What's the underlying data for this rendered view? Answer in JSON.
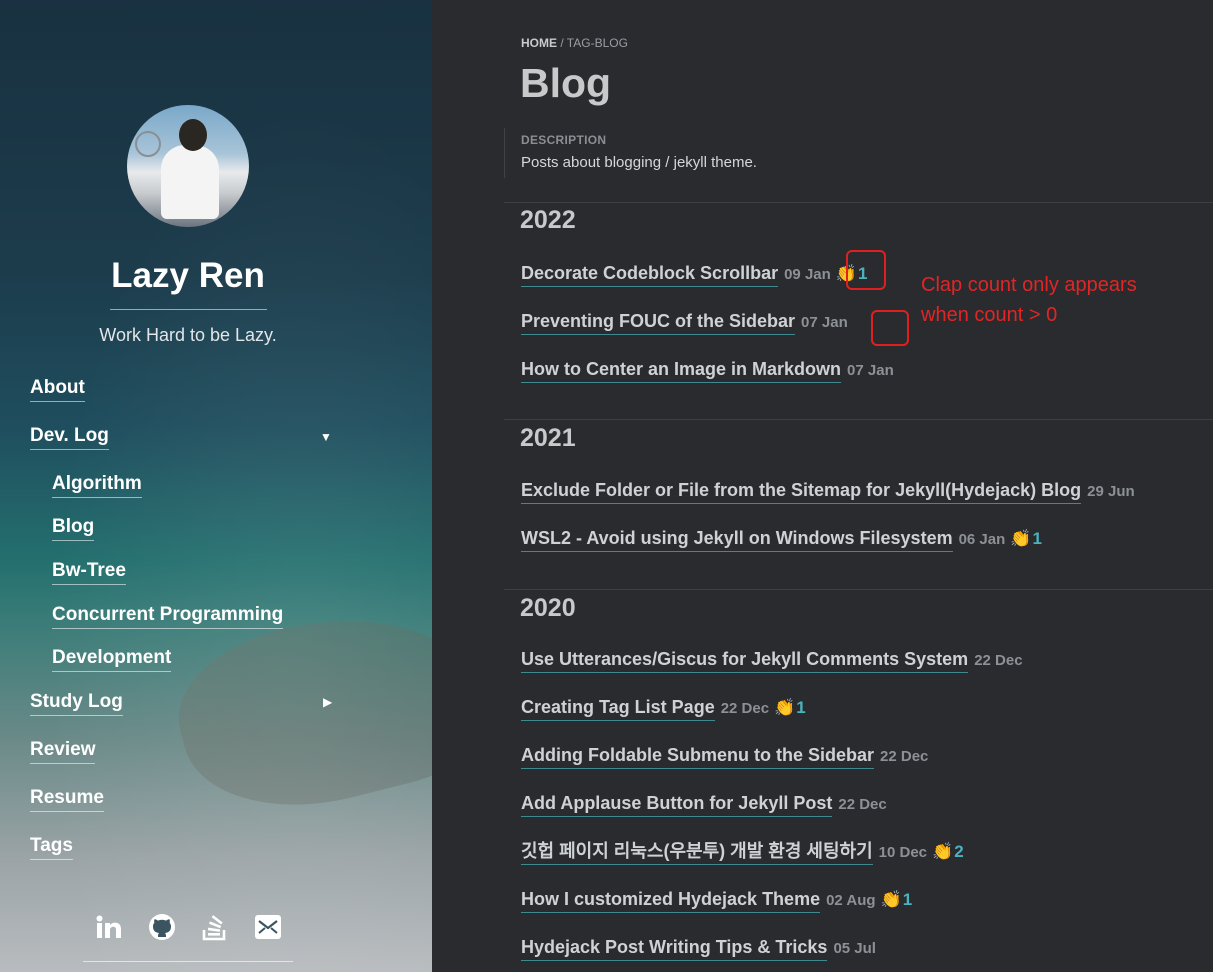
{
  "sidebar": {
    "site_title": "Lazy Ren",
    "tagline": "Work Hard to be Lazy.",
    "nav": {
      "about": "About",
      "dev_log": "Dev. Log",
      "algorithm": "Algorithm",
      "blog": "Blog",
      "bw_tree": "Bw-Tree",
      "concurrent": "Concurrent Programming",
      "development": "Development",
      "study_log": "Study Log",
      "review": "Review",
      "resume": "Resume",
      "tags": "Tags"
    },
    "social_icons": [
      "linkedin-icon",
      "github-icon",
      "stackoverflow-icon",
      "email-icon"
    ]
  },
  "main": {
    "breadcrumb": {
      "home": "HOME",
      "separator": " / ",
      "current": "TAG-BLOG"
    },
    "title": "Blog",
    "description_label": "DESCRIPTION",
    "description": "Posts about blogging / jekyll theme.",
    "years": [
      {
        "year": "2022",
        "posts": [
          {
            "title": "Decorate Codeblock Scrollbar",
            "date": "09 Jan",
            "claps": "1"
          },
          {
            "title": "Preventing FOUC of the Sidebar",
            "date": "07 Jan",
            "claps": ""
          },
          {
            "title": "How to Center an Image in Markdown",
            "date": "07 Jan",
            "claps": ""
          }
        ]
      },
      {
        "year": "2021",
        "posts": [
          {
            "title": "Exclude Folder or File from the Sitemap for Jekyll(Hydejack) Blog",
            "date": "29 Jun",
            "claps": ""
          },
          {
            "title": "WSL2 - Avoid using Jekyll on Windows Filesystem",
            "date": "06 Jan",
            "claps": "1"
          }
        ]
      },
      {
        "year": "2020",
        "posts": [
          {
            "title": "Use Utterances/Giscus for Jekyll Comments System",
            "date": "22 Dec",
            "claps": ""
          },
          {
            "title": "Creating Tag List Page",
            "date": "22 Dec",
            "claps": "1"
          },
          {
            "title": "Adding Foldable Submenu to the Sidebar",
            "date": "22 Dec",
            "claps": ""
          },
          {
            "title": "Add Applause Button for Jekyll Post",
            "date": "22 Dec",
            "claps": ""
          },
          {
            "title": "깃헙 페이지 리눅스(우분투) 개발 환경 세팅하기",
            "date": "10 Dec",
            "claps": "2"
          },
          {
            "title": "How I customized Hydejack Theme",
            "date": "02 Aug",
            "claps": "1"
          },
          {
            "title": "Hydejack Post Writing Tips & Tricks",
            "date": "05 Jul",
            "claps": ""
          }
        ]
      }
    ]
  },
  "annotation": {
    "line1": "Clap count only appears",
    "line2": "when count > 0",
    "color": "#e02020"
  },
  "colors": {
    "accent": "#4ab3bd",
    "link_underline": "#3f8a91",
    "background": "#292b2e"
  }
}
